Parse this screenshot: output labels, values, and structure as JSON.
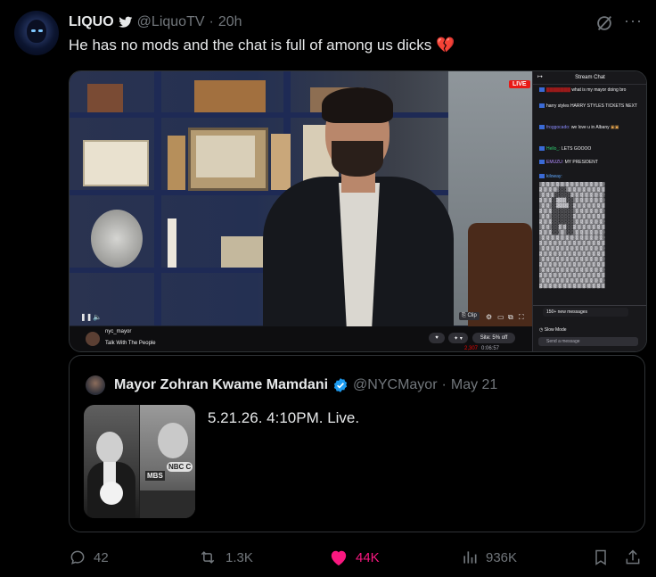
{
  "tweet": {
    "author_name": "LIQUO",
    "author_handle": "@LiquoTV",
    "separator": "·",
    "time": "20h",
    "text": "He has no mods and the chat is full of among us dicks 💔"
  },
  "video": {
    "live_badge": "LIVE",
    "channel_name": "nyc_mayor",
    "stream_title": "Talk With The People",
    "offer_label": "Site: 5% off",
    "viewer_count": "2,307",
    "uptime": "0:06:57",
    "clip_label": "Clip",
    "chat": {
      "title": "Stream Chat",
      "messages": [
        {
          "user": "",
          "text": "what is my mayor doing bro"
        },
        {
          "user": "",
          "text": "harry styles  HARRY STYLES TICKETS NEXT"
        },
        {
          "user": "froggocado:",
          "text": "we love u in Albany"
        },
        {
          "user": "Hello_:",
          "text": "LETS GOOOO"
        },
        {
          "user": "EMUZU:",
          "text": "MY PRESIDENT"
        },
        {
          "user": "kiloway:",
          "text": ""
        }
      ],
      "new_messages": "150+ new messages",
      "slow_mode": "Slow Mode",
      "send_placeholder": "Send a message"
    }
  },
  "quote": {
    "author_name": "Mayor Zohran Kwame Mamdani",
    "author_handle": "@NYCMayor",
    "separator": "·",
    "date": "May 21",
    "text": "5.21.26. 4:10PM. Live.",
    "image_sign_left": "MBS",
    "image_sign_right": "NBC C"
  },
  "actions": {
    "replies": "42",
    "reposts": "1.3K",
    "likes": "44K",
    "views": "936K"
  },
  "colors": {
    "like": "#f91880",
    "muted": "#71767b",
    "verified": "#1d9bf0",
    "live_red": "#e91916",
    "twitch_purple": "#9147ff"
  }
}
